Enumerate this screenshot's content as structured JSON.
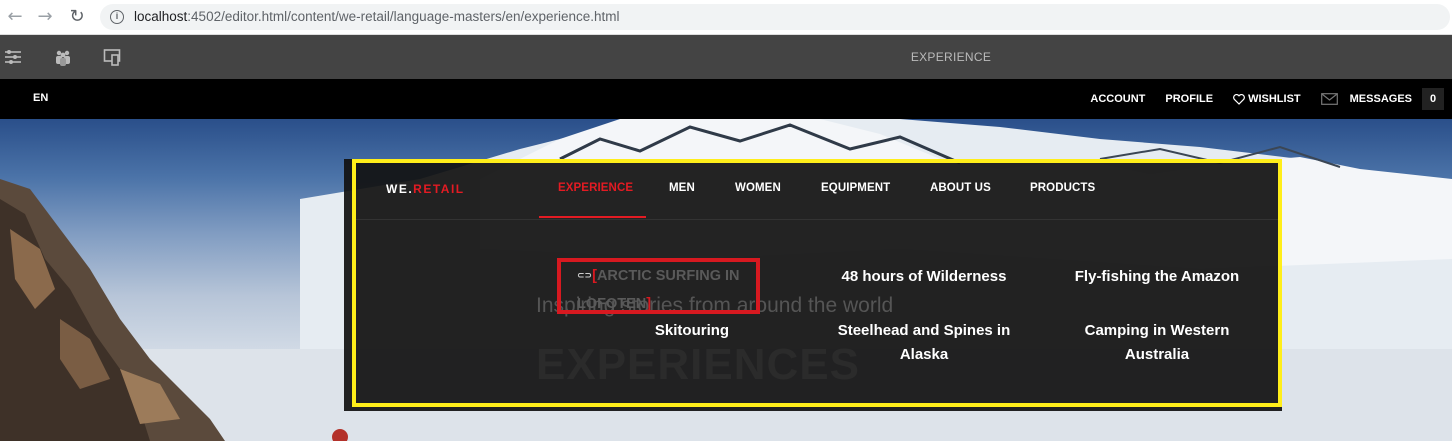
{
  "browser": {
    "url_host": "localhost",
    "url_rest": ":4502/editor.html/content/we-retail/language-masters/en/experience.html",
    "back_icon": "←",
    "forward_icon": "→",
    "reload_icon": "↻"
  },
  "aem_toolbar": {
    "title": "EXPERIENCE"
  },
  "site_header": {
    "language": "EN",
    "links": [
      {
        "label": "ACCOUNT"
      },
      {
        "label": "PROFILE"
      },
      {
        "label": "WISHLIST"
      },
      {
        "label": "MESSAGES"
      }
    ],
    "message_count": "0"
  },
  "menu": {
    "logo_prefix": "WE.",
    "logo_suffix": "RETAIL",
    "nav": [
      {
        "label": "EXPERIENCE",
        "active": true
      },
      {
        "label": "MEN"
      },
      {
        "label": "WOMEN"
      },
      {
        "label": "EQUIPMENT"
      },
      {
        "label": "ABOUT US"
      },
      {
        "label": "PRODUCTS"
      }
    ],
    "placeholder_open": "[",
    "placeholder_text": "ARCTIC SURFING IN LOFOTEN",
    "placeholder_close": "]",
    "items": [
      {
        "label": "48 hours of Wilderness"
      },
      {
        "label": "Fly-fishing the Amazon"
      },
      {
        "label": "Skitouring"
      },
      {
        "label": "Steelhead and Spines in Alaska"
      },
      {
        "label": "Camping in Western Australia"
      }
    ],
    "ghost_subtitle": "Inspiring stories from around the world",
    "ghost_title": "EXPERIENCES"
  },
  "colors": {
    "accent_red": "#e31b23",
    "highlight_yellow": "#ffee1a",
    "toolbar_gray": "#444444"
  }
}
